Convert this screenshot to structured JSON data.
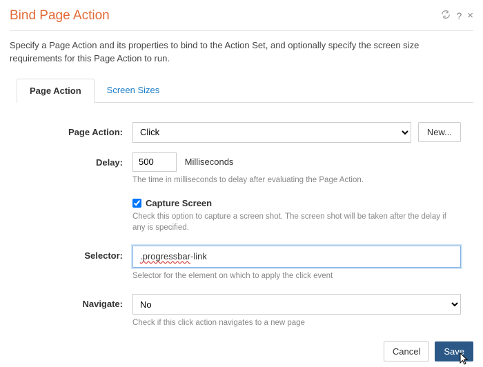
{
  "header": {
    "title": "Bind Page Action",
    "help_symbol": "?",
    "close_symbol": "×"
  },
  "description": "Specify a Page Action and its properties to bind to the Action Set, and optionally specify the screen size requirements for this Page Action to run.",
  "tabs": {
    "page_action": "Page Action",
    "screen_sizes": "Screen Sizes"
  },
  "form": {
    "page_action": {
      "label": "Page Action:",
      "value": "Click",
      "new_button": "New..."
    },
    "delay": {
      "label": "Delay:",
      "value": "500",
      "unit": "Milliseconds",
      "help": "The time in milliseconds to delay after evaluating the Page Action."
    },
    "capture": {
      "label": "Capture Screen",
      "checked": true,
      "help": "Check this option to capture a screen shot. The screen shot will be taken after the delay if any is specified."
    },
    "selector": {
      "label": "Selector:",
      "value_prefix": ".progressbar",
      "value_suffix": "-link",
      "help": "Selector for the element on which to apply the click event"
    },
    "navigate": {
      "label": "Navigate:",
      "value": "No",
      "help": "Check if this click action navigates to a new page"
    }
  },
  "footer": {
    "cancel": "Cancel",
    "save": "Save"
  }
}
